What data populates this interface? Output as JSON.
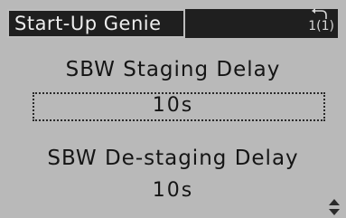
{
  "screen": {
    "title": "Start-Up Genie",
    "menu_index": "1(1)",
    "menu_index_icon": "back-arrow-icon",
    "updown_icon": "up-down-arrow-icon"
  },
  "params": [
    {
      "label": "SBW Staging Delay",
      "value": "10s"
    },
    {
      "label": "SBW De-staging Delay",
      "value": "10s"
    }
  ]
}
